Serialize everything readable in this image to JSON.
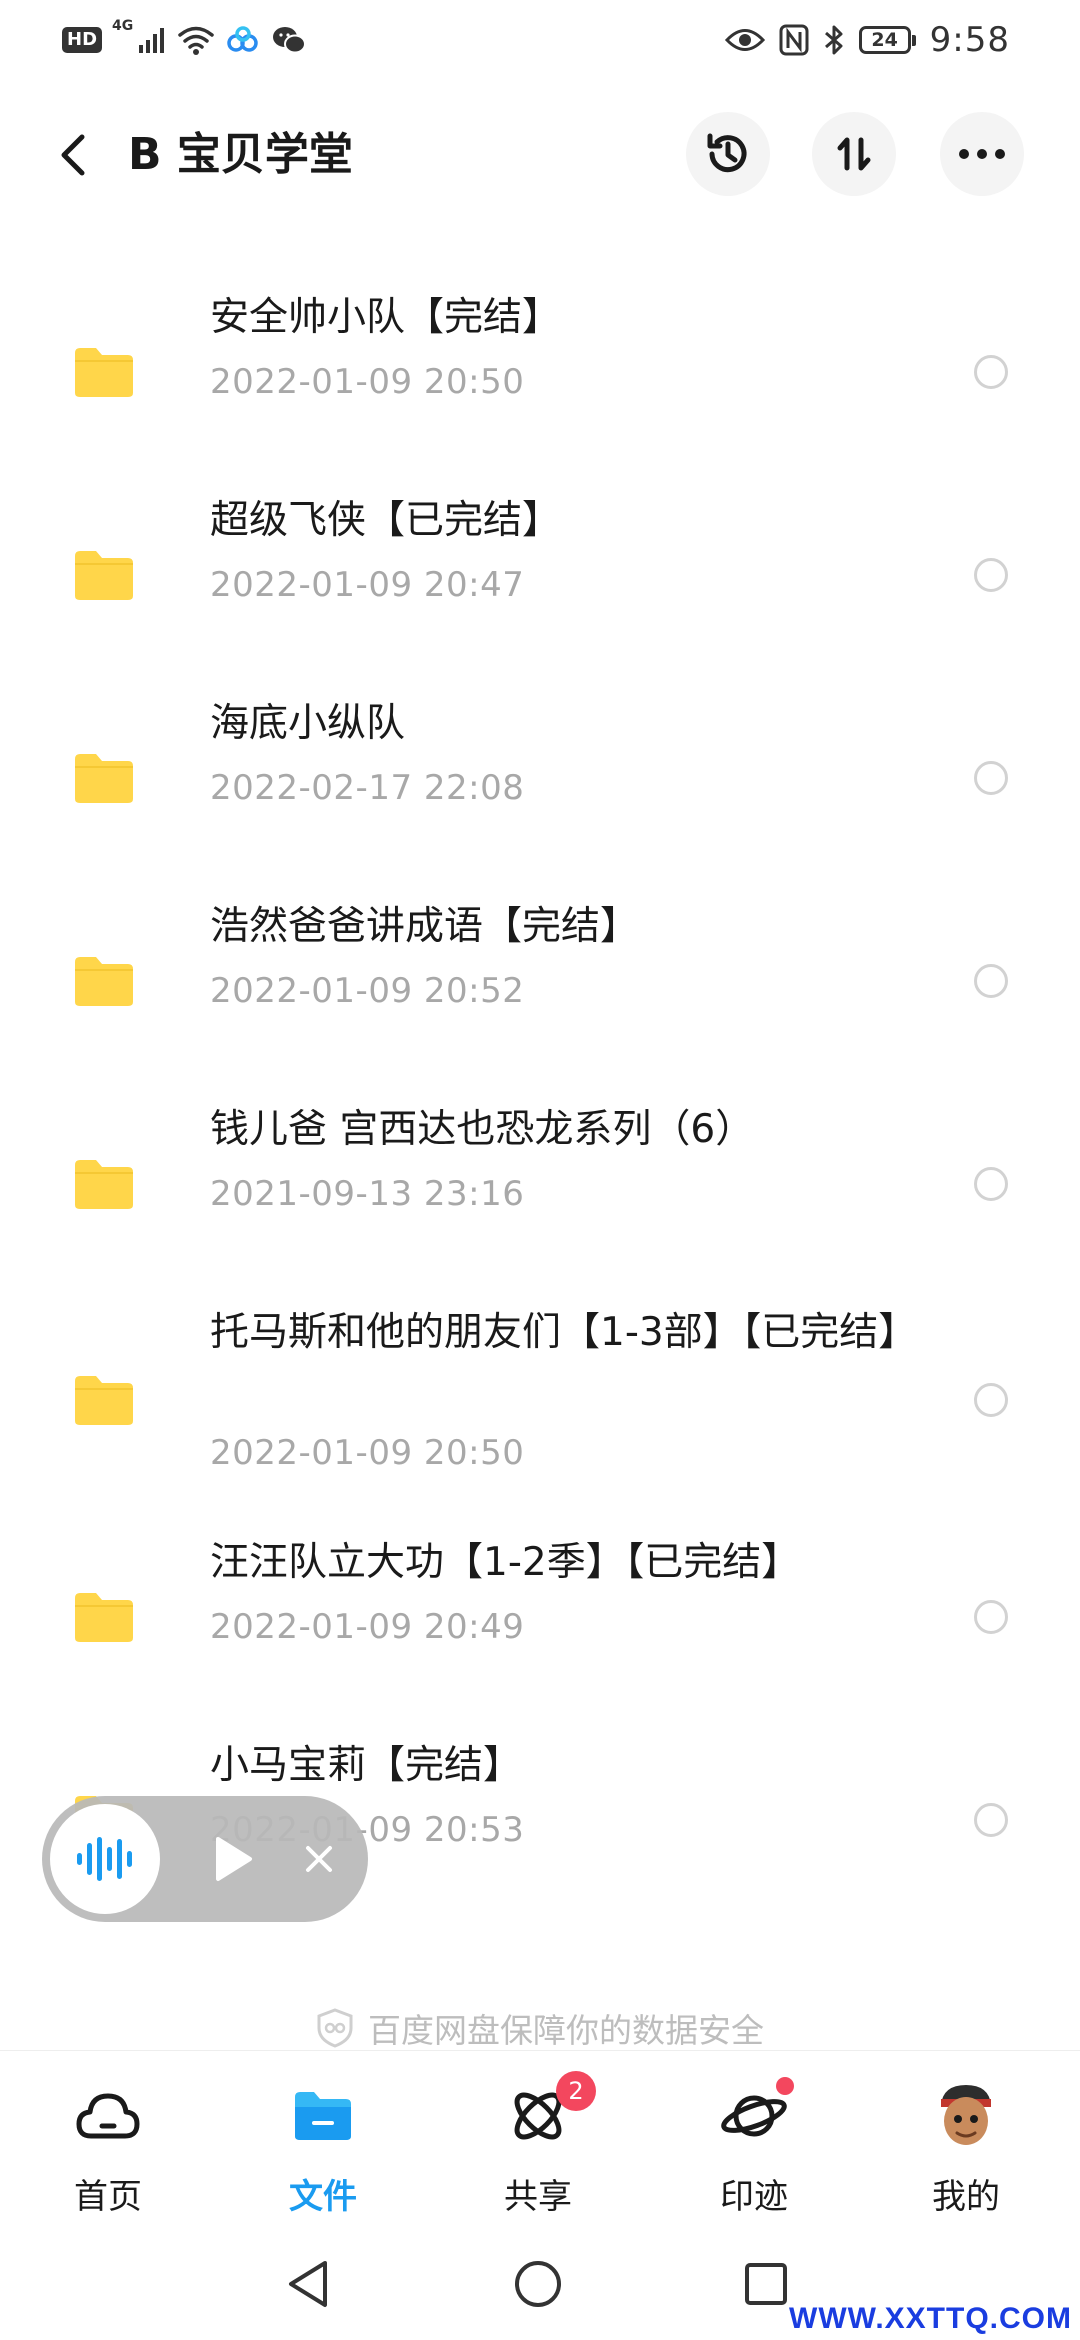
{
  "status_bar": {
    "hd": "HD",
    "network": "4G",
    "battery": "24",
    "time": "9:58"
  },
  "header": {
    "back_icon": "chevron-left-icon",
    "title": "B 宝贝学堂",
    "history_icon": "history-icon",
    "sort_icon": "sort-icon",
    "more_icon": "more-icon"
  },
  "files": [
    {
      "name": "安全帅小队【完结】",
      "date": "2022-01-09  20:50"
    },
    {
      "name": "超级飞侠【已完结】",
      "date": "2022-01-09  20:47"
    },
    {
      "name": "海底小纵队",
      "date": "2022-02-17  22:08"
    },
    {
      "name": "浩然爸爸讲成语【完结】",
      "date": "2022-01-09  20:52"
    },
    {
      "name": "钱儿爸 宫西达也恐龙系列（6）",
      "date": "2021-09-13  23:16"
    },
    {
      "name": "托马斯和他的朋友们【1-3部】【已完结】",
      "date": "2022-01-09  20:50"
    },
    {
      "name": "汪汪队立大功【1-2季】【已完结】",
      "date": "2022-01-09  20:49"
    },
    {
      "name": "小马宝莉【完结】",
      "date": "2022-01-09  20:53"
    }
  ],
  "audio_player": {
    "wave_icon": "audio-wave-icon",
    "play_icon": "play-icon",
    "close_icon": "close-icon"
  },
  "safety_note": "百度网盘保障你的数据安全",
  "bottom_nav": [
    {
      "label": "首页",
      "icon": "cloud-icon",
      "active": false
    },
    {
      "label": "文件",
      "icon": "folder-icon",
      "active": true
    },
    {
      "label": "共享",
      "icon": "atom-icon",
      "badge": "2"
    },
    {
      "label": "印迹",
      "icon": "planet-icon",
      "dot": true
    },
    {
      "label": "我的",
      "icon": "avatar-icon"
    }
  ],
  "watermark": "WWW.XXTTQ.COM",
  "colors": {
    "accent": "#1a9bf0",
    "folder": "#ffd64a",
    "badge": "#f3475e",
    "date_text": "#a8a8a8"
  }
}
